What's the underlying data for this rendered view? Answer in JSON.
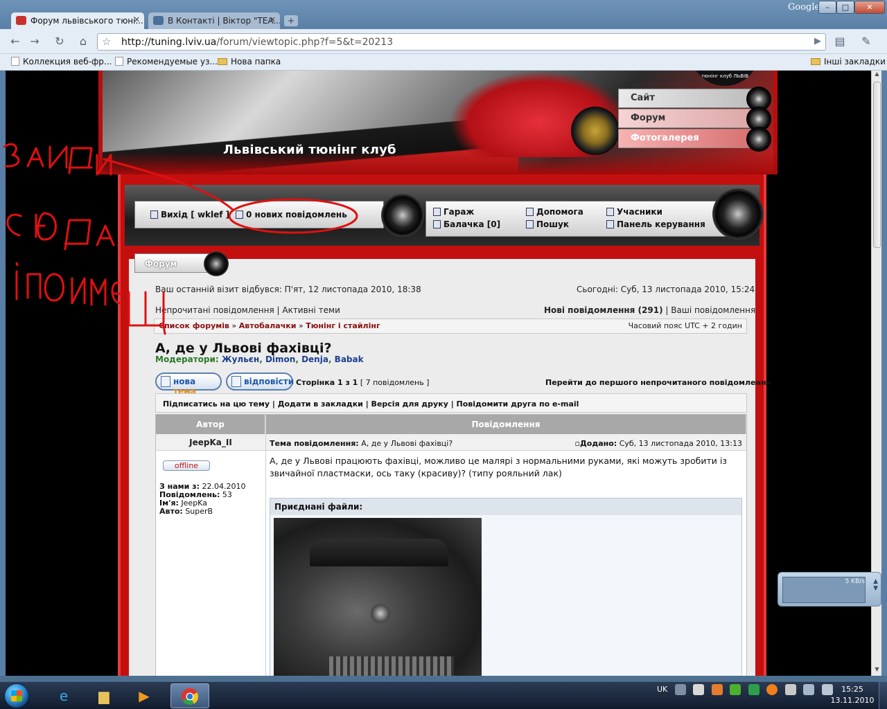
{
  "browser": {
    "brand": "Google",
    "tabs": [
      {
        "label": "Форум львівського тюні...",
        "active": true
      },
      {
        "label": "В Контакті | Віктор \"TEA...",
        "active": false
      }
    ],
    "url_host": "http://tuning.lviv.ua",
    "url_path": "/forum/viewtopic.php?f=5&t=20213",
    "bookmarks": [
      {
        "label": "Коллекция веб-фр...",
        "type": "page"
      },
      {
        "label": "Рекомендуемые уз...",
        "type": "page"
      },
      {
        "label": "Нова папка",
        "type": "folder"
      }
    ],
    "other_bookmarks": "Інші закладки"
  },
  "site": {
    "title": "Львівський тюнінг клуб",
    "logo_text": "тюнінг клуб ЛЬВІВ",
    "side_nav": [
      "Сайт",
      "Форум",
      "Фотогалерея"
    ]
  },
  "user_menu": {
    "logout": "Вихід [ wklef ]",
    "new_messages": "0 нових повідомлень",
    "garage": "Гараж",
    "chat": "Балачка [0]",
    "help": "Допомога",
    "search": "Пошук",
    "members": "Учасники",
    "control_panel": "Панель керування"
  },
  "forum": {
    "tab_label": "Форум",
    "last_visit": "Ваш останній візит відбувся: П'ят, 12 листопада 2010, 18:38",
    "today": "Сьогодні: Суб, 13 листопада 2010, 15:24",
    "unread_link": "Непрочитані повідомлення",
    "active_link": "Активні теми",
    "new_posts_link": "Нові повідомлення (291)",
    "your_posts_link": "Ваші повідомлення",
    "breadcrumb": [
      "Список форумів",
      "Автобалачки",
      "Тюнінг і стайлінг"
    ],
    "timezone": "Часовий пояс UTC + 2 годин",
    "topic_title": "А, де у Львові фахівці?",
    "moderators_label": "Модератори:",
    "moderators": [
      "Жульєн",
      "Dimon",
      "Denja",
      "Babak"
    ],
    "btn_new_topic_a": "нова",
    "btn_new_topic_b": "тема",
    "btn_reply": "відповісти",
    "pagination": "Сторінка 1 з 1",
    "post_count": "[ 7 повідомлень ]",
    "jump_unread": "Перейти до першого непрочитаного повідомлення",
    "actions": "Підписатись на цю тему | Додати в закладки | Версія для друку | Повідомити друга по e-mail",
    "col_author": "Автор",
    "col_message": "Повідомлення"
  },
  "post": {
    "author": "JeepKa_II",
    "status": "offline",
    "joined_label": "З нами з:",
    "joined": "22.04.2010",
    "posts_label": "Повідомлень:",
    "posts": "53",
    "name_label": "Ім'я:",
    "name": "JeepKa",
    "car_label": "Авто:",
    "car": "SuperB",
    "subject_label": "Тема повідомлення:",
    "subject": "А, де у Львові фахівці?",
    "posted_label": "Додано:",
    "posted": "Суб, 13 листопада 2010, 13:13",
    "body": "А, де у Львові працюють фахівці, можливо це малярі з нормальними руками, які можуть зробити із звичайної пластмаски, ось таку (красиву)? (типу рояльний лак)",
    "attachments_label": "Приєднані файли:"
  },
  "widget": {
    "speed": "5 KB/s"
  },
  "taskbar": {
    "lang": "UK",
    "time": "15:25",
    "date": "13.11.2010"
  },
  "colors": {
    "forum_red": "#c40f0f",
    "annotation_red": "#e01010",
    "link_blue": "#1d3f8f",
    "moderator_green": "#2b7a2b"
  }
}
